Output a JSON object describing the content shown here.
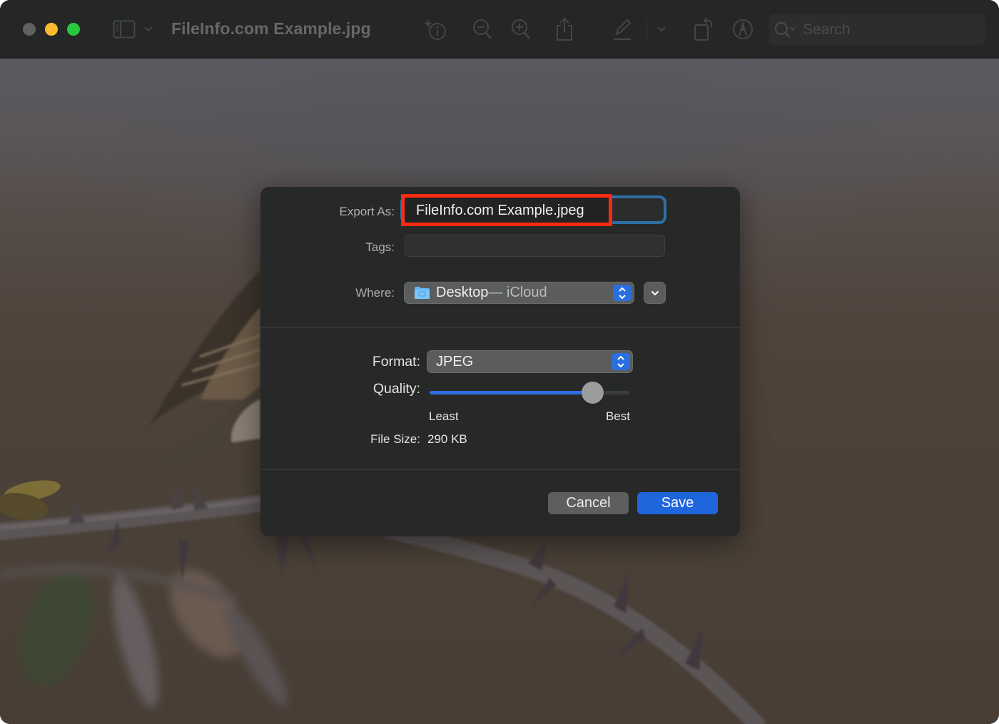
{
  "window": {
    "title": "FileInfo.com Example.jpg",
    "traffic_lights": {
      "close_color": "#5f6161",
      "minimize_color": "#fcbb2f",
      "maximize_color": "#29c840"
    }
  },
  "toolbar": {
    "icons": [
      "sidebar-icon",
      "chevron-down-icon",
      "info-sparkle-icon",
      "zoom-out-icon",
      "zoom-in-icon",
      "share-icon",
      "markup-pen-icon",
      "chevron-down-icon",
      "rotate-icon",
      "markup-circle-icon"
    ],
    "search": {
      "placeholder": "Search"
    }
  },
  "export_dialog": {
    "export_as": {
      "label": "Export As:",
      "value": "FileInfo.com Example.jpeg"
    },
    "tags": {
      "label": "Tags:",
      "value": ""
    },
    "where": {
      "label": "Where:",
      "location_primary": "Desktop",
      "location_secondary": " — iCloud",
      "icon": "folder-icon"
    },
    "format": {
      "label": "Format:",
      "selected": "JPEG"
    },
    "quality": {
      "label": "Quality:",
      "min_label": "Least",
      "max_label": "Best",
      "value_fraction": 0.81
    },
    "file_size": {
      "label": "File Size:",
      "value": "290 KB"
    },
    "buttons": {
      "cancel": "Cancel",
      "save": "Save"
    },
    "accent_color": "#1f66dd",
    "annotation_highlight_color": "#ff2a12"
  }
}
